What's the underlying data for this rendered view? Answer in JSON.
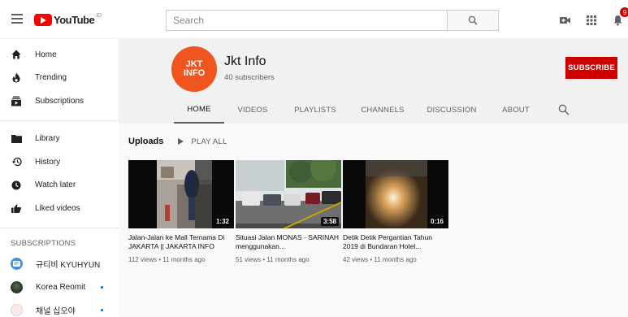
{
  "header": {
    "logo_text": "YouTube",
    "logo_sup": "ID",
    "search_placeholder": "Search",
    "notification_count": "9"
  },
  "sidebar": {
    "main_items": [
      {
        "label": "Home",
        "icon": "home-icon"
      },
      {
        "label": "Trending",
        "icon": "trending-icon"
      },
      {
        "label": "Subscriptions",
        "icon": "subscriptions-icon"
      }
    ],
    "library_items": [
      {
        "label": "Library",
        "icon": "library-icon"
      },
      {
        "label": "History",
        "icon": "history-icon"
      },
      {
        "label": "Watch later",
        "icon": "watch-later-icon"
      },
      {
        "label": "Liked videos",
        "icon": "liked-videos-icon"
      }
    ],
    "subscriptions_heading": "SUBSCRIPTIONS",
    "subscriptions": [
      {
        "label": "규티비 KYUHYUN",
        "color": "#4a90d9"
      },
      {
        "label": "Korea Reomit",
        "color": "#3a4a3a"
      },
      {
        "label": "채널 십오야",
        "color": "#f2c9c9"
      }
    ]
  },
  "channel": {
    "avatar_line1": "JKT",
    "avatar_line2": "INFO",
    "name": "Jkt Info",
    "subscribers": "40 subscribers",
    "subscribe_label": "SUBSCRIBE",
    "brand_color": "#f0551f"
  },
  "tabs": [
    {
      "label": "HOME",
      "active": true
    },
    {
      "label": "VIDEOS",
      "active": false
    },
    {
      "label": "PLAYLISTS",
      "active": false
    },
    {
      "label": "CHANNELS",
      "active": false
    },
    {
      "label": "DISCUSSION",
      "active": false
    },
    {
      "label": "ABOUT",
      "active": false
    }
  ],
  "uploads": {
    "title": "Uploads",
    "play_all": "PLAY ALL",
    "videos": [
      {
        "title": "Jalan-Jalan ke Mall Ternama Di JAKARTA || JAKARTA INFO",
        "meta": "112 views • 11 months ago",
        "duration": "1:32"
      },
      {
        "title": "Situasi Jalan MONAS - SARINAH menggunakan...",
        "meta": "51 views • 11 months ago",
        "duration": "3:58"
      },
      {
        "title": "Detik Detik Pergantian Tahun 2019 di Bundaran Hotel...",
        "meta": "42 views • 11 months ago",
        "duration": "0:16"
      }
    ]
  }
}
